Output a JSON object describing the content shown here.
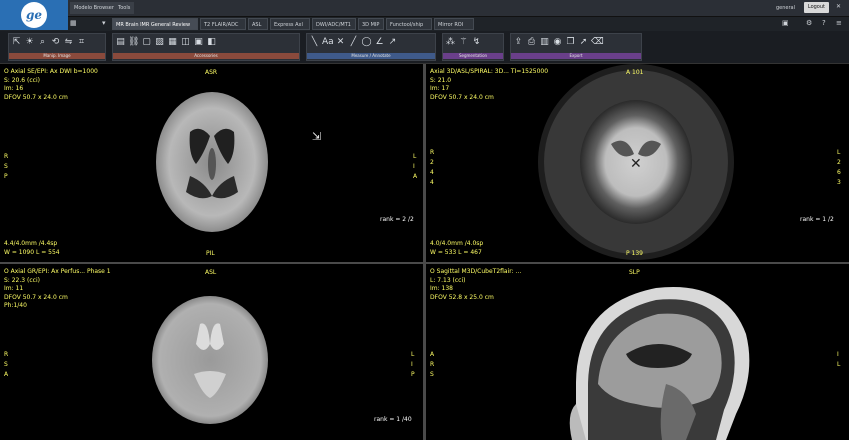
{
  "top": {
    "tabs": [
      "Modelo Browser",
      "Tools"
    ],
    "user": "general",
    "logout": "Logout"
  },
  "protocol_tabs": [
    {
      "label": "MR Brain IMR General Review",
      "active": true
    },
    {
      "label": "T2 FLAIR/ADC",
      "active": false
    },
    {
      "label": "ASL",
      "active": false
    },
    {
      "label": "Express Axl",
      "active": false
    },
    {
      "label": "DWI/ADC/MT1",
      "active": false
    },
    {
      "label": "3D MIP",
      "active": false
    },
    {
      "label": "Functool/ship",
      "active": false
    },
    {
      "label": "Mirror ROI",
      "active": false
    }
  ],
  "toolbar_groups": [
    {
      "label": "Manip. Image",
      "icons": [
        "pointer-icon",
        "brightness-icon",
        "zoom-icon",
        "rotate-icon",
        "flip-icon",
        "crop-icon"
      ]
    },
    {
      "label": "Accessories",
      "icons": [
        "layout-icon",
        "link-icon",
        "page-icon",
        "image-icon",
        "grid-icon",
        "cube-icon",
        "save-icon",
        "stack-icon"
      ]
    },
    {
      "label": "Measure / Annotate",
      "icons": [
        "line-icon",
        "text-icon",
        "cross-icon",
        "ruler-icon",
        "ellipse-icon",
        "angle-icon",
        "arrow-icon"
      ]
    },
    {
      "label": "Segmentation",
      "icons": [
        "segment-icon",
        "wand-icon",
        "brush-icon"
      ]
    },
    {
      "label": "Export",
      "icons": [
        "export-icon",
        "print-icon",
        "film-icon",
        "camera-icon",
        "copy-icon",
        "send-icon",
        "clear-icon"
      ]
    }
  ],
  "viewports": {
    "tl": {
      "header": [
        "O Axial SE/EPI: Ax DWI b=1000",
        "S: 20.6 (cci)",
        "Im: 16",
        "DFOV 50.7 x 24.0 cm"
      ],
      "top_orient": "ASR",
      "bottom_orient": "PIL",
      "left_side": [
        "R",
        "S",
        "P"
      ],
      "right_side": [
        "L",
        "I",
        "A"
      ],
      "rank": "rank = 2 /2",
      "bottom": [
        "4.4/4.0mm /4.4sp",
        "W = 1090 L = 554"
      ]
    },
    "tr": {
      "header": [
        "Axial 3D/ASL/SPIRAL: 3D... TI=1525000",
        "S: 21.0",
        "Im: 17",
        "DFOV 50.7 x 24.0 cm"
      ],
      "top_orient": "A 101",
      "bottom_orient": "P 139",
      "left_side": [
        "R",
        "2",
        "4",
        "4"
      ],
      "right_side": [
        "L",
        "2",
        "6",
        "3"
      ],
      "rank": "rank = 1 /2",
      "bottom": [
        "4.0/4.0mm /4.0sp",
        "W = 533 L = 467"
      ]
    },
    "bl": {
      "header": [
        "O Axial GR/EPI: Ax Perfus... Phase 1",
        "S: 22.3 (cci)",
        "Im: 11",
        "DFOV 50.7 x 24.0 cm",
        "Ph:1/40"
      ],
      "top_orient": "ASL",
      "left_side": [
        "R",
        "S",
        "A"
      ],
      "right_side": [
        "L",
        "I",
        "P"
      ],
      "rank": "rank = 1 /40"
    },
    "br": {
      "header": [
        "O Sagittal M3D/CubeT2flair: ...",
        "L: 7.13 (cci)",
        "Im: 138",
        "DFOV 52.8 x 25.0 cm"
      ],
      "top_orient": "SLP",
      "left_side": [
        "A",
        "R",
        "S"
      ],
      "right_side": [
        "I",
        "L"
      ]
    }
  }
}
